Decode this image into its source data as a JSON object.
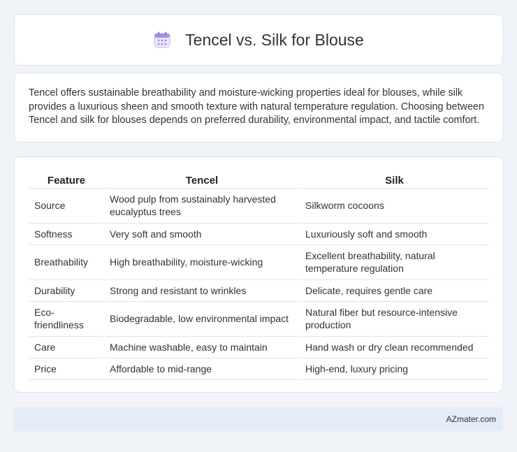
{
  "header": {
    "title": "Tencel vs. Silk for Blouse",
    "icon": "calendar-icon"
  },
  "intro": {
    "text": "Tencel offers sustainable breathability and moisture-wicking properties ideal for blouses, while silk provides a luxurious sheen and smooth texture with natural temperature regulation. Choosing between Tencel and silk for blouses depends on preferred durability, environmental impact, and tactile comfort."
  },
  "table": {
    "headers": [
      "Feature",
      "Tencel",
      "Silk"
    ],
    "rows": [
      [
        "Source",
        "Wood pulp from sustainably harvested eucalyptus trees",
        "Silkworm cocoons"
      ],
      [
        "Softness",
        "Very soft and smooth",
        "Luxuriously soft and smooth"
      ],
      [
        "Breathability",
        "High breathability, moisture-wicking",
        "Excellent breathability, natural temperature regulation"
      ],
      [
        "Durability",
        "Strong and resistant to wrinkles",
        "Delicate, requires gentle care"
      ],
      [
        "Eco-friendliness",
        "Biodegradable, low environmental impact",
        "Natural fiber but resource-intensive production"
      ],
      [
        "Care",
        "Machine washable, easy to maintain",
        "Hand wash or dry clean recommended"
      ],
      [
        "Price",
        "Affordable to mid-range",
        "High-end, luxury pricing"
      ]
    ]
  },
  "footer": {
    "text": "AZmater.com"
  },
  "colors": {
    "background": "#f0f3f8",
    "card": "#ffffff",
    "footer": "#e4ecf7",
    "icon_accent": "#a98ee8"
  }
}
